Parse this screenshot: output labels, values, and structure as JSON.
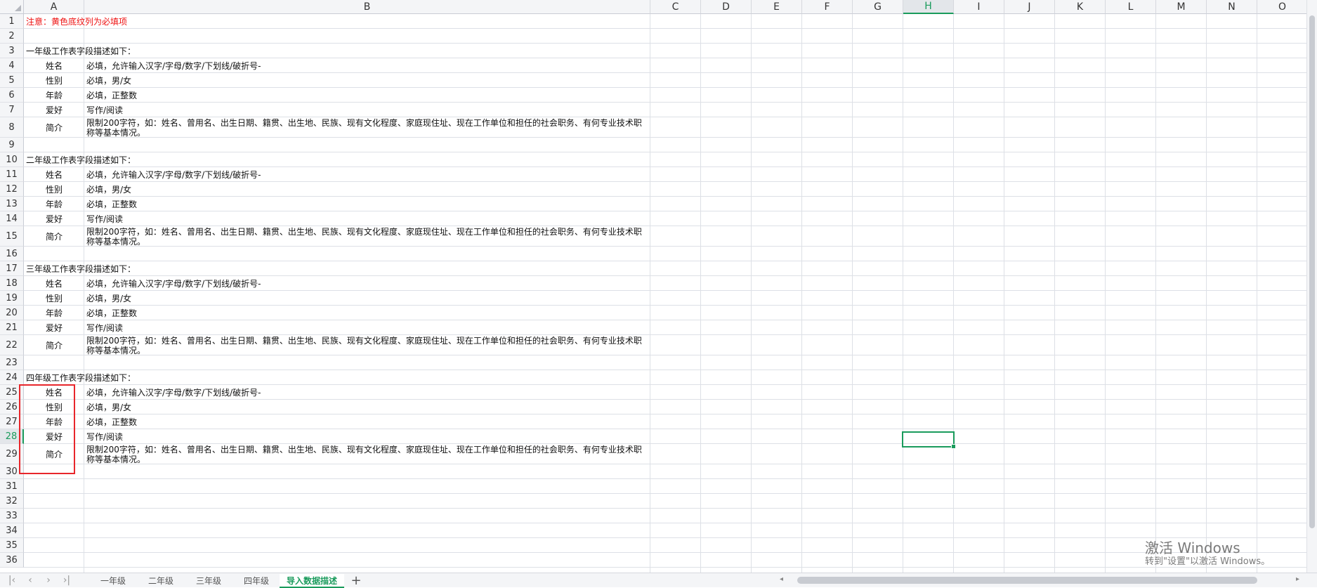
{
  "columns": [
    {
      "key": "A",
      "label": "A"
    },
    {
      "key": "B",
      "label": "B"
    },
    {
      "key": "C",
      "label": "C"
    },
    {
      "key": "D",
      "label": "D"
    },
    {
      "key": "E",
      "label": "E"
    },
    {
      "key": "F",
      "label": "F"
    },
    {
      "key": "G",
      "label": "G"
    },
    {
      "key": "H",
      "label": "H"
    },
    {
      "key": "I",
      "label": "I"
    },
    {
      "key": "J",
      "label": "J"
    },
    {
      "key": "K",
      "label": "K"
    },
    {
      "key": "L",
      "label": "L"
    },
    {
      "key": "M",
      "label": "M"
    },
    {
      "key": "N",
      "label": "N"
    },
    {
      "key": "O",
      "label": "O"
    }
  ],
  "row_numbers": [
    "1",
    "2",
    "3",
    "4",
    "5",
    "6",
    "7",
    "8",
    "9",
    "10",
    "11",
    "12",
    "13",
    "14",
    "15",
    "16",
    "17",
    "18",
    "19",
    "20",
    "21",
    "22",
    "23",
    "24",
    "25",
    "26",
    "27",
    "28",
    "29",
    "30",
    "31",
    "32",
    "33",
    "34",
    "35",
    "36"
  ],
  "selected_cell": {
    "column": "H",
    "row": "28"
  },
  "cells": [
    {
      "row": 1,
      "col": "A",
      "text": "注意：黄色底纹列为必填项",
      "style": "red"
    },
    {
      "row": 3,
      "col": "A",
      "text": "一年级工作表字段描述如下："
    },
    {
      "row": 4,
      "col": "A",
      "text": "姓名",
      "style": "center"
    },
    {
      "row": 4,
      "col": "B",
      "text": "必填，允许输入汉字/字母/数字/下划线/破折号-"
    },
    {
      "row": 5,
      "col": "A",
      "text": "性别",
      "style": "center"
    },
    {
      "row": 5,
      "col": "B",
      "text": "必填，男/女"
    },
    {
      "row": 6,
      "col": "A",
      "text": "年龄",
      "style": "center"
    },
    {
      "row": 6,
      "col": "B",
      "text": "必填，正整数"
    },
    {
      "row": 7,
      "col": "A",
      "text": "爱好",
      "style": "center"
    },
    {
      "row": 7,
      "col": "B",
      "text": "写作/阅读"
    },
    {
      "row": 8,
      "col": "A",
      "text": "简介",
      "style": "center"
    },
    {
      "row": 8,
      "col": "B",
      "text": "限制200字符，如：姓名、曾用名、出生日期、籍贯、出生地、民族、现有文化程度、家庭现住址、现在工作单位和担任的社会职务、有何专业技术职称等基本情况。",
      "style": "wrap"
    },
    {
      "row": 10,
      "col": "A",
      "text": "二年级工作表字段描述如下："
    },
    {
      "row": 11,
      "col": "A",
      "text": "姓名",
      "style": "center"
    },
    {
      "row": 11,
      "col": "B",
      "text": "必填，允许输入汉字/字母/数字/下划线/破折号-"
    },
    {
      "row": 12,
      "col": "A",
      "text": "性别",
      "style": "center"
    },
    {
      "row": 12,
      "col": "B",
      "text": "必填，男/女"
    },
    {
      "row": 13,
      "col": "A",
      "text": "年龄",
      "style": "center"
    },
    {
      "row": 13,
      "col": "B",
      "text": "必填，正整数"
    },
    {
      "row": 14,
      "col": "A",
      "text": "爱好",
      "style": "center"
    },
    {
      "row": 14,
      "col": "B",
      "text": "写作/阅读"
    },
    {
      "row": 15,
      "col": "A",
      "text": "简介",
      "style": "center"
    },
    {
      "row": 15,
      "col": "B",
      "text": "限制200字符，如：姓名、曾用名、出生日期、籍贯、出生地、民族、现有文化程度、家庭现住址、现在工作单位和担任的社会职务、有何专业技术职称等基本情况。",
      "style": "wrap"
    },
    {
      "row": 17,
      "col": "A",
      "text": "三年级工作表字段描述如下："
    },
    {
      "row": 18,
      "col": "A",
      "text": "姓名",
      "style": "center"
    },
    {
      "row": 18,
      "col": "B",
      "text": "必填，允许输入汉字/字母/数字/下划线/破折号-"
    },
    {
      "row": 19,
      "col": "A",
      "text": "性别",
      "style": "center"
    },
    {
      "row": 19,
      "col": "B",
      "text": "必填，男/女"
    },
    {
      "row": 20,
      "col": "A",
      "text": "年龄",
      "style": "center"
    },
    {
      "row": 20,
      "col": "B",
      "text": "必填，正整数"
    },
    {
      "row": 21,
      "col": "A",
      "text": "爱好",
      "style": "center"
    },
    {
      "row": 21,
      "col": "B",
      "text": "写作/阅读"
    },
    {
      "row": 22,
      "col": "A",
      "text": "简介",
      "style": "center"
    },
    {
      "row": 22,
      "col": "B",
      "text": "限制200字符，如：姓名、曾用名、出生日期、籍贯、出生地、民族、现有文化程度、家庭现住址、现在工作单位和担任的社会职务、有何专业技术职称等基本情况。",
      "style": "wrap"
    },
    {
      "row": 24,
      "col": "A",
      "text": "四年级工作表字段描述如下："
    },
    {
      "row": 25,
      "col": "A",
      "text": "姓名",
      "style": "center"
    },
    {
      "row": 25,
      "col": "B",
      "text": "必填，允许输入汉字/字母/数字/下划线/破折号-"
    },
    {
      "row": 26,
      "col": "A",
      "text": "性别",
      "style": "center"
    },
    {
      "row": 26,
      "col": "B",
      "text": "必填，男/女"
    },
    {
      "row": 27,
      "col": "A",
      "text": "年龄",
      "style": "center"
    },
    {
      "row": 27,
      "col": "B",
      "text": "必填，正整数"
    },
    {
      "row": 28,
      "col": "A",
      "text": "爱好",
      "style": "center"
    },
    {
      "row": 28,
      "col": "B",
      "text": "写作/阅读"
    },
    {
      "row": 29,
      "col": "A",
      "text": "简介",
      "style": "center"
    },
    {
      "row": 29,
      "col": "B",
      "text": "限制200字符，如：姓名、曾用名、出生日期、籍贯、出生地、民族、现有文化程度、家庭现住址、现在工作单位和担任的社会职务、有何专业技术职称等基本情况。",
      "style": "wrap"
    }
  ],
  "sheet_tabs": {
    "tabs": [
      "一年级",
      "二年级",
      "三年级",
      "四年级",
      "导入数据描述"
    ],
    "active": "导入数据描述",
    "add_label": "+"
  },
  "nav_icons": [
    "first-sheet-icon",
    "prev-sheet-icon",
    "next-sheet-icon",
    "last-sheet-icon"
  ],
  "watermark": {
    "title": "激活 Windows",
    "subtitle": "转到\"设置\"以激活 Windows。"
  },
  "colors": {
    "accent": "#1a9b5c",
    "note_red": "#ee1111",
    "annotation_red": "#e8262b"
  }
}
